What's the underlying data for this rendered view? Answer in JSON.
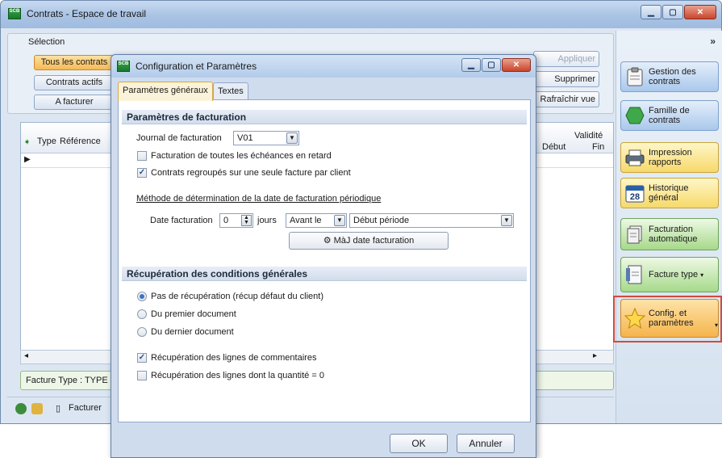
{
  "main_window": {
    "title": "Contrats - Espace de travail",
    "app_icon_text": "SCB",
    "selection_label": "Sélection",
    "selection_buttons": [
      "Tous les contrats",
      "Contrats actifs",
      "A facturer"
    ],
    "right_buttons": [
      "Appliquer",
      "Supprimer",
      "Rafraîchir vue"
    ],
    "grid": {
      "columns": [
        "Type",
        "Référence",
        "Validité",
        "Début",
        "Fin"
      ]
    },
    "facture_type_text": "Facture Type : TYPE",
    "bottom_toolbar": {
      "facturer_label": "Facturer"
    }
  },
  "sidebar": {
    "chevron": "»",
    "buttons": [
      {
        "label": "Gestion des contrats",
        "icon": "clipboard-icon"
      },
      {
        "label": "Famille de contrats",
        "icon": "hexagon-icon"
      },
      {
        "label": "Impression rapports",
        "icon": "printer-icon"
      },
      {
        "label": "Historique général",
        "icon": "calendar-icon",
        "calendar_day": "28"
      },
      {
        "label": "Facturation automatique",
        "icon": "invoice-stack-icon"
      },
      {
        "label": "Facture type",
        "icon": "document-icon"
      },
      {
        "label": "Config. et paramètres",
        "icon": "star-icon"
      }
    ]
  },
  "dialog": {
    "title": "Configuration et Paramètres",
    "tabs": [
      "Paramètres généraux",
      "Textes"
    ],
    "active_tab": 0,
    "billing": {
      "section_title": "Paramètres de facturation",
      "journal_label": "Journal de facturation",
      "journal_value": "V01",
      "checkbox_all_due": {
        "label": "Facturation de toutes les échéances en retard",
        "checked": false
      },
      "checkbox_grouped": {
        "label": "Contrats regroupés sur une seule facture par client",
        "checked": true
      },
      "method_label": "Méthode de détermination de la date de facturation périodique",
      "date_label": "Date facturation",
      "date_offset": "0",
      "days_label": "jours",
      "relation_value": "Avant le",
      "reference_value": "Début période",
      "update_button": "MàJ date facturation"
    },
    "conditions": {
      "section_title": "Récupération des conditions générales",
      "radios": [
        {
          "label": "Pas de récupération (récup défaut du client)",
          "selected": true
        },
        {
          "label": "Du premier document",
          "selected": false
        },
        {
          "label": "Du dernier document",
          "selected": false
        }
      ],
      "checkbox_comments": {
        "label": "Récupération des lignes de commentaires",
        "checked": true
      },
      "checkbox_zero_qty": {
        "label": "Récupération des lignes dont la quantité = 0",
        "checked": false
      }
    },
    "ok_label": "OK",
    "cancel_label": "Annuler"
  }
}
